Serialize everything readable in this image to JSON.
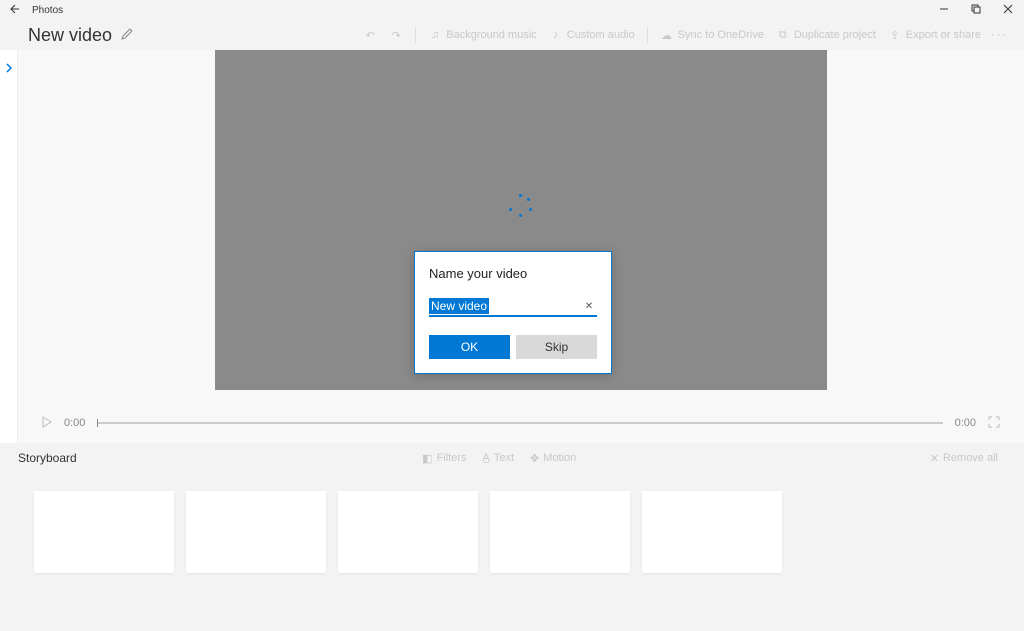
{
  "titlebar": {
    "app_name": "Photos"
  },
  "commandbar": {
    "project_title": "New video",
    "buttons": {
      "bg_music": "Background music",
      "custom_audio": "Custom audio",
      "sync": "Sync to OneDrive",
      "duplicate": "Duplicate project",
      "export": "Export or share"
    }
  },
  "transport": {
    "time_start": "0:00",
    "time_end": "0:00"
  },
  "storyboard": {
    "title": "Storyboard",
    "buttons": {
      "filters": "Filters",
      "text": "Text",
      "motion": "Motion",
      "remove_all": "Remove all"
    }
  },
  "dialog": {
    "title": "Name your video",
    "value": "New video",
    "ok": "OK",
    "skip": "Skip"
  }
}
